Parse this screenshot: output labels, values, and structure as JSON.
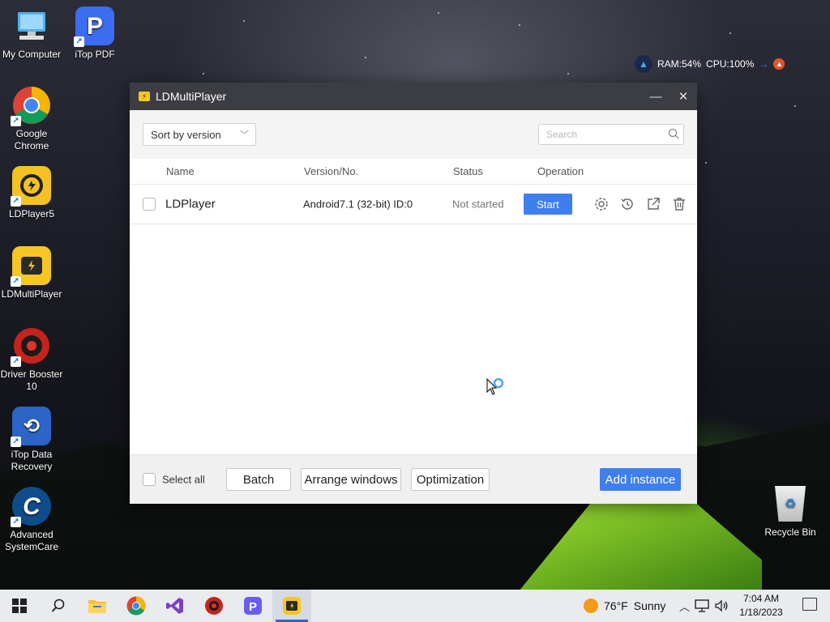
{
  "desktop": {
    "icons": [
      {
        "label": "My Computer",
        "glyph": "▭",
        "color": "#3aa0ea"
      },
      {
        "label": "iTop PDF",
        "glyph": "P",
        "color": "#3c6cf0"
      },
      {
        "label": "Google Chrome",
        "glyph": "●",
        "color": "#e84437"
      },
      {
        "label": "LDPlayer5",
        "glyph": "◐",
        "color": "#f4c223"
      },
      {
        "label": "LDMultiPlayer",
        "glyph": "⚡",
        "color": "#f6c623"
      },
      {
        "label": "Driver Booster 10",
        "glyph": "⚙",
        "color": "#e2312c"
      },
      {
        "label": "iTop Data Recovery",
        "glyph": "⟲",
        "color": "#2c64c8"
      },
      {
        "label": "Advanced SystemCare",
        "glyph": "C",
        "color": "#1a8ae0"
      }
    ],
    "recycle_bin": "Recycle Bin"
  },
  "perf_monitor": {
    "ram": "RAM:54%",
    "cpu": "CPU:100%"
  },
  "window": {
    "title": "LDMultiPlayer",
    "minimize_glyph": "—",
    "close_glyph": "✕",
    "sort_label": "Sort by version",
    "search_placeholder": "Search",
    "columns": {
      "name": "Name",
      "version": "Version/No.",
      "status": "Status",
      "operation": "Operation"
    },
    "rows": [
      {
        "name": "LDPlayer",
        "version": "Android7.1 (32-bit) ID:0",
        "status": "Not started",
        "action": "Start"
      }
    ],
    "footer": {
      "select_all": "Select all",
      "batch": "Batch",
      "arrange": "Arrange windows",
      "optimization": "Optimization",
      "add_instance": "Add instance"
    },
    "accent": "#3f7ef0"
  },
  "taskbar": {
    "weather_temp": "76°F",
    "weather_text": "Sunny",
    "time": "7:04 AM",
    "date": "1/18/2023"
  }
}
